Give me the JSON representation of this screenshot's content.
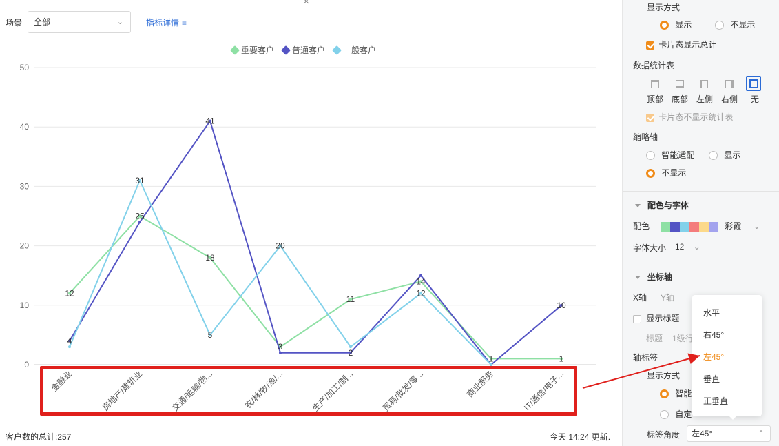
{
  "toolbar": {
    "scene_label": "场景",
    "scene_value": "全部",
    "detail_link": "指标详情",
    "close_glyph": "×"
  },
  "legend": [
    "重要客户",
    "普通客户",
    "一般客户"
  ],
  "footer": {
    "total": "客户数的总计:257",
    "updated": "今天 14:24 更新."
  },
  "chart_data": {
    "type": "line",
    "categories": [
      "金融业",
      "房地产/建筑业",
      "交通/运输/物...",
      "农/林/牧/渔/...",
      "生产/加工/制...",
      "贸易/批发/零...",
      "商业服务",
      "IT/通信/电子..."
    ],
    "series": [
      {
        "name": "重要客户",
        "color": "#8ee0a4",
        "values": [
          12,
          25,
          18,
          3,
          11,
          14,
          1,
          1
        ]
      },
      {
        "name": "普通客户",
        "color": "#5454c4",
        "values": [
          4,
          24,
          41,
          2,
          2,
          15,
          0,
          10
        ]
      },
      {
        "name": "一般客户",
        "color": "#82d1ea",
        "values": [
          3,
          31,
          5,
          20,
          3,
          12,
          0,
          null
        ]
      }
    ],
    "point_labels": [
      {
        "x": "金融业",
        "y": 12,
        "text": "12"
      },
      {
        "x": "金融业",
        "y": 4,
        "text": "4"
      },
      {
        "x": "房地产/建筑业",
        "y": 31,
        "text": "31"
      },
      {
        "x": "房地产/建筑业",
        "y": 25,
        "text": "25"
      },
      {
        "x": "交通/运输/物...",
        "y": 41,
        "text": "41"
      },
      {
        "x": "交通/运输/物...",
        "y": 18,
        "text": "18"
      },
      {
        "x": "交通/运输/物...",
        "y": 5,
        "text": "5"
      },
      {
        "x": "农/林/牧/渔/...",
        "y": 20,
        "text": "20"
      },
      {
        "x": "农/林/牧/渔/...",
        "y": 3,
        "text": "3"
      },
      {
        "x": "生产/加工/制...",
        "y": 11,
        "text": "11"
      },
      {
        "x": "生产/加工/制...",
        "y": 2,
        "text": "2"
      },
      {
        "x": "贸易/批发/零...",
        "y": 14,
        "text": "14"
      },
      {
        "x": "贸易/批发/零...",
        "y": 12,
        "text": "12"
      },
      {
        "x": "商业服务",
        "y": 1,
        "text": "1"
      },
      {
        "x": "IT/通信/电子...",
        "y": 10,
        "text": "10"
      },
      {
        "x": "IT/通信/电子...",
        "y": 1,
        "text": "1"
      }
    ],
    "yticks": [
      0,
      10,
      20,
      30,
      40,
      50
    ],
    "ylim": [
      0,
      50
    ],
    "x_label_rotation_deg": -45,
    "grid": true,
    "legend_position": "top-center"
  },
  "settings": {
    "display_mode_title": "显示方式",
    "display_show": "显示",
    "display_hide": "不显示",
    "card_total": "卡片态显示总计",
    "stats_table_title": "数据统计表",
    "stats_positions": [
      "顶部",
      "底部",
      "左侧",
      "右侧",
      "无"
    ],
    "card_no_stats": "卡片态不显示统计表",
    "thumb_axis_title": "缩略轴",
    "thumb_smart": "智能适配",
    "thumb_show": "显示",
    "thumb_hide": "不显示",
    "color_font_title": "配色与字体",
    "color_label": "配色",
    "palette_name": "彩霞",
    "palette": [
      "#8ee0a4",
      "#5454c4",
      "#82d1ea",
      "#f47c7c",
      "#fcd98a",
      "#a3a3ee"
    ],
    "font_size_label": "字体大小",
    "font_size_value": "12",
    "axis_title": "坐标轴",
    "x_axis_tab": "X轴",
    "y_axis_tab": "Y轴",
    "show_title": "显示标题",
    "title_label": "标题",
    "title_value": "1级行",
    "axis_label_title": "轴标签",
    "axis_display_mode": "显示方式",
    "axis_smart": "智能",
    "axis_custom": "自定",
    "label_angle_label": "标签角度",
    "label_angle_value": "左45°"
  },
  "angle_dropdown": {
    "options": [
      "水平",
      "右45°",
      "左45°",
      "垂直",
      "正垂直"
    ],
    "selected": "左45°",
    "accent": "#f08c1a"
  },
  "annotation_color": "#e0201c"
}
